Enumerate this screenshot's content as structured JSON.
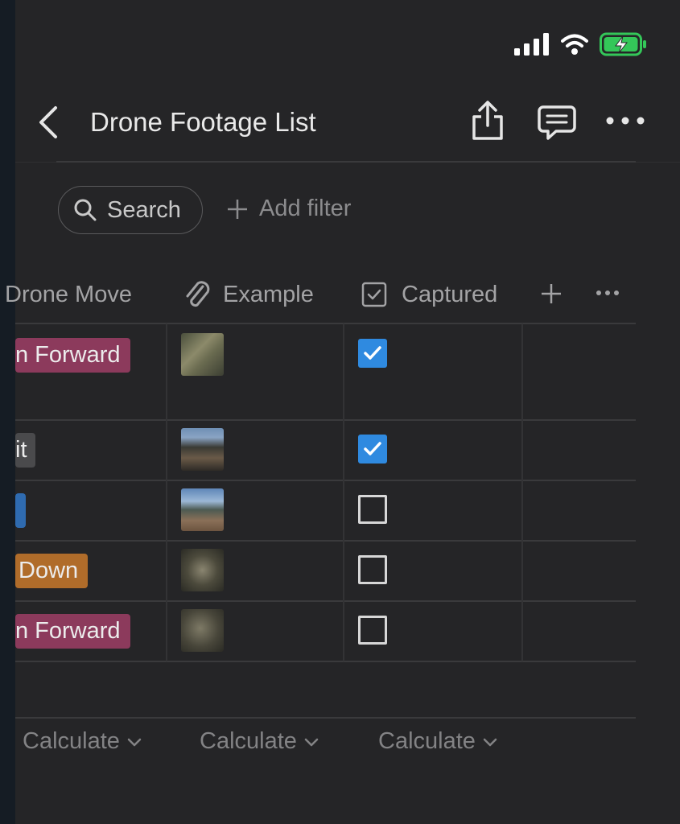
{
  "status_bar": {
    "signal_icon": "cellular-signal-icon",
    "wifi_icon": "wifi-icon",
    "battery_icon": "battery-charging-icon",
    "battery_color": "#34c759"
  },
  "navbar": {
    "title": "Drone Footage List"
  },
  "toolbar": {
    "search_label": "Search",
    "add_filter_label": "Add filter"
  },
  "columns": [
    {
      "label": "Drone Move",
      "icon": ""
    },
    {
      "label": "Example",
      "icon": "paperclip-icon"
    },
    {
      "label": "Captured",
      "icon": "checkbox-icon"
    }
  ],
  "rows": [
    {
      "tag": "n Forward",
      "tag_color": "#8c3a5c",
      "example": "coastal cliff photo",
      "captured": true
    },
    {
      "tag": "it",
      "tag_color": "#4a4a4c",
      "example": "coastline aerial photo",
      "captured": true
    },
    {
      "tag": "",
      "tag_color": "#2f6bb0",
      "example": "sand dunes photo",
      "captured": false
    },
    {
      "tag": "Down",
      "tag_color": "#b06c2a",
      "example": "rock formation photo",
      "captured": false
    },
    {
      "tag": "n Forward",
      "tag_color": "#8c3a5c",
      "example": "rock formation photo",
      "captured": false
    }
  ],
  "footer": {
    "calculate_labels": [
      "Calculate",
      "Calculate",
      "Calculate"
    ]
  },
  "colors": {
    "background": "#252527",
    "checkbox_checked": "#2f8ae0"
  }
}
